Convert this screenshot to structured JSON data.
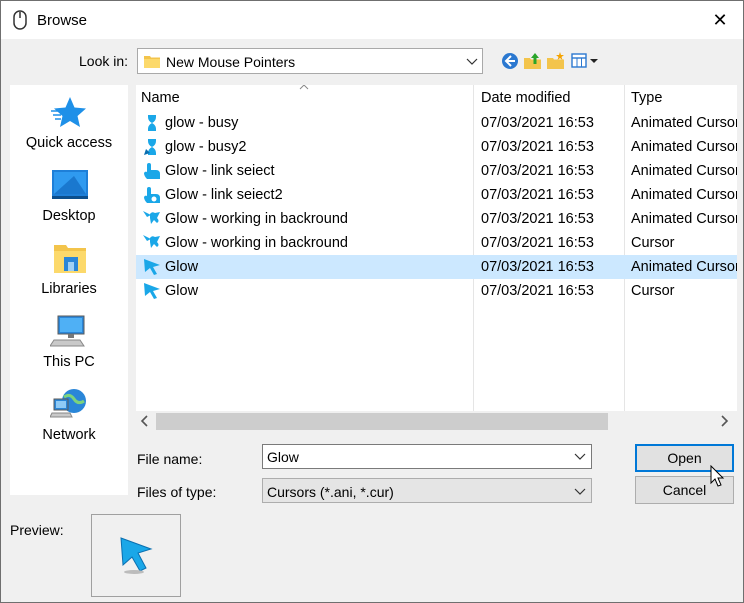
{
  "window": {
    "title": "Browse",
    "close_glyph": "✕"
  },
  "toolbar": {
    "look_in_label": "Look in:",
    "look_in_value": "New Mouse Pointers",
    "tools": [
      "back-icon",
      "up-folder-icon",
      "new-folder-icon",
      "view-menu-icon"
    ]
  },
  "places": [
    {
      "label": "Quick access",
      "icon": "quick-access-star-icon"
    },
    {
      "label": "Desktop",
      "icon": "desktop-icon"
    },
    {
      "label": "Libraries",
      "icon": "libraries-icon"
    },
    {
      "label": "This PC",
      "icon": "this-pc-icon"
    },
    {
      "label": "Network",
      "icon": "network-icon"
    }
  ],
  "files": {
    "columns": [
      "Name",
      "Date modified",
      "Type"
    ],
    "rows": [
      {
        "name": "glow - busy",
        "date": "07/03/2021 16:53",
        "type": "Animated Cursor",
        "icon": "hourglass-cursor-icon"
      },
      {
        "name": "glow - busy2",
        "date": "07/03/2021 16:53",
        "type": "Animated Cursor",
        "icon": "hourglass-cursor-icon"
      },
      {
        "name": "Glow - link seiect",
        "date": "07/03/2021 16:53",
        "type": "Animated Cursor",
        "icon": "hand-cursor-icon"
      },
      {
        "name": "Glow - link seiect2",
        "date": "07/03/2021 16:53",
        "type": "Animated Cursor",
        "icon": "hand-cursor-icon"
      },
      {
        "name": "Glow - working in backround",
        "date": "07/03/2021 16:53",
        "type": "Animated Cursor",
        "icon": "working-cursor-icon"
      },
      {
        "name": "Glow - working in backround",
        "date": "07/03/2021 16:53",
        "type": "Cursor",
        "icon": "working-cursor-icon"
      },
      {
        "name": "Glow",
        "date": "07/03/2021 16:53",
        "type": "Animated Cursor",
        "icon": "arrow-cursor-icon",
        "selected": true
      },
      {
        "name": "Glow",
        "date": "07/03/2021 16:53",
        "type": "Cursor",
        "icon": "arrow-cursor-icon"
      }
    ]
  },
  "form": {
    "file_name_label": "File name:",
    "file_name_value": "Glow",
    "file_type_label": "Files of type:",
    "file_type_value": "Cursors (*.ani, *.cur)"
  },
  "buttons": {
    "open": "Open",
    "cancel": "Cancel"
  },
  "preview": {
    "label": "Preview:"
  },
  "colors": {
    "selection": "#cce8ff",
    "accent": "#0078d7",
    "cursor_glow": "#1aa7e8"
  }
}
